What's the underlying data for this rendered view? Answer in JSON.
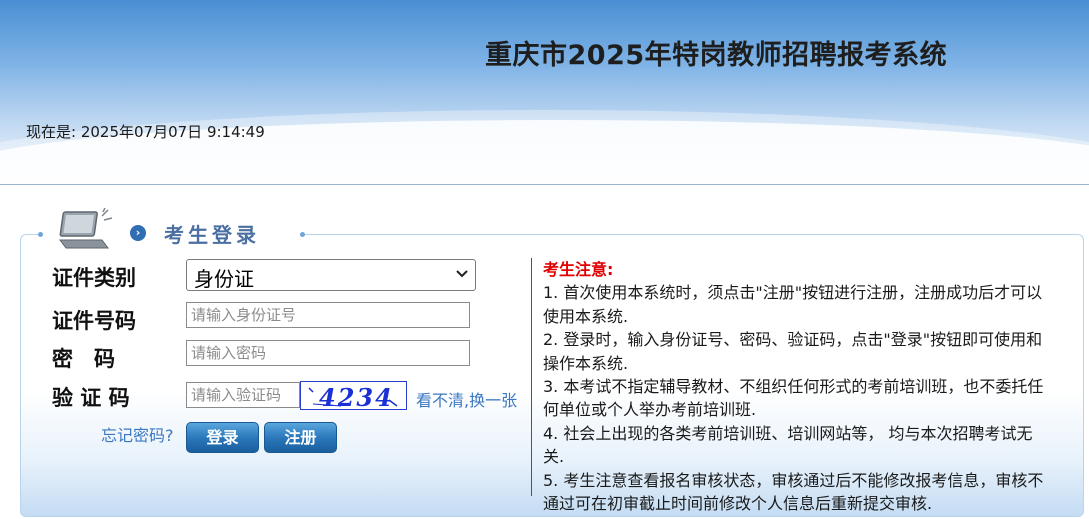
{
  "header": {
    "title": "重庆市2025年特岗教师招聘报考系统",
    "clock": "现在是: 2025年07月07日 9:14:49"
  },
  "login": {
    "title": "考生登录",
    "id_type_label": "证件类别",
    "id_type_value": "身份证",
    "id_number_label": "证件号码",
    "id_number_placeholder": "请输入身份证号",
    "password_label": "密　码",
    "password_placeholder": "请输入密码",
    "captcha_label": "验 证 码",
    "captcha_placeholder": "请输入验证码",
    "captcha_text": "4234",
    "refresh_label": "看不清,换一张",
    "forgot_label": "忘记密码?",
    "login_button": "登录",
    "register_button": "注册"
  },
  "notice": {
    "title": "考生注意:",
    "items": [
      "1. 首次使用本系统时，须点击\"注册\"按钮进行注册，注册成功后才可以使用本系统.",
      "2. 登录时，输入身份证号、密码、验证码，点击\"登录\"按钮即可使用和操作本系统.",
      "3. 本考试不指定辅导教材、不组织任何形式的考前培训班，也不委托任何单位或个人举办考前培训班.",
      "4. 社会上出现的各类考前培训班、培训网站等， 均与本次招聘考试无关.",
      "5. 考生注意查看报名审核状态，审核通过后不能修改报考信息，审核不通过可在初审截止时间前修改个人信息后重新提交审核."
    ]
  },
  "colors": {
    "header_top": "#4a8fd3",
    "link": "#3b78c2",
    "button": "#2b78bb",
    "notice_title": "#e00000",
    "captcha": "#1a2fd6"
  }
}
